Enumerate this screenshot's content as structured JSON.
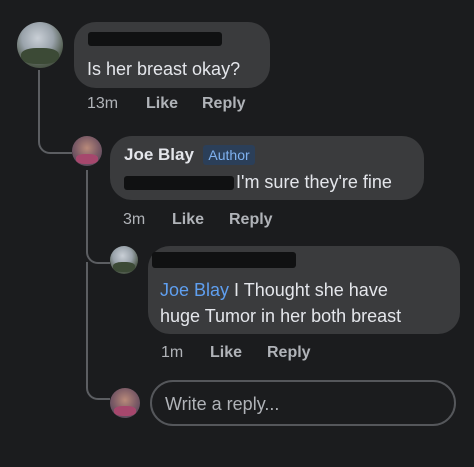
{
  "comments": [
    {
      "text": "Is her breast okay?",
      "time": "13m",
      "like_label": "Like",
      "reply_label": "Reply"
    },
    {
      "author": "Joe Blay",
      "badge": "Author",
      "text": "I'm sure they're fine",
      "time": "3m",
      "like_label": "Like",
      "reply_label": "Reply"
    },
    {
      "mention": "Joe Blay",
      "text_line1": " I Thought she have",
      "text_line2": "huge Tumor in her both breast",
      "time": "1m",
      "like_label": "Like",
      "reply_label": "Reply"
    }
  ],
  "reply_box": {
    "placeholder": "Write a reply..."
  },
  "colors": {
    "background": "#1b1c1e",
    "bubble": "#3a3b3d",
    "mention": "#5f9ff0",
    "meta": "#b0b3b8"
  }
}
